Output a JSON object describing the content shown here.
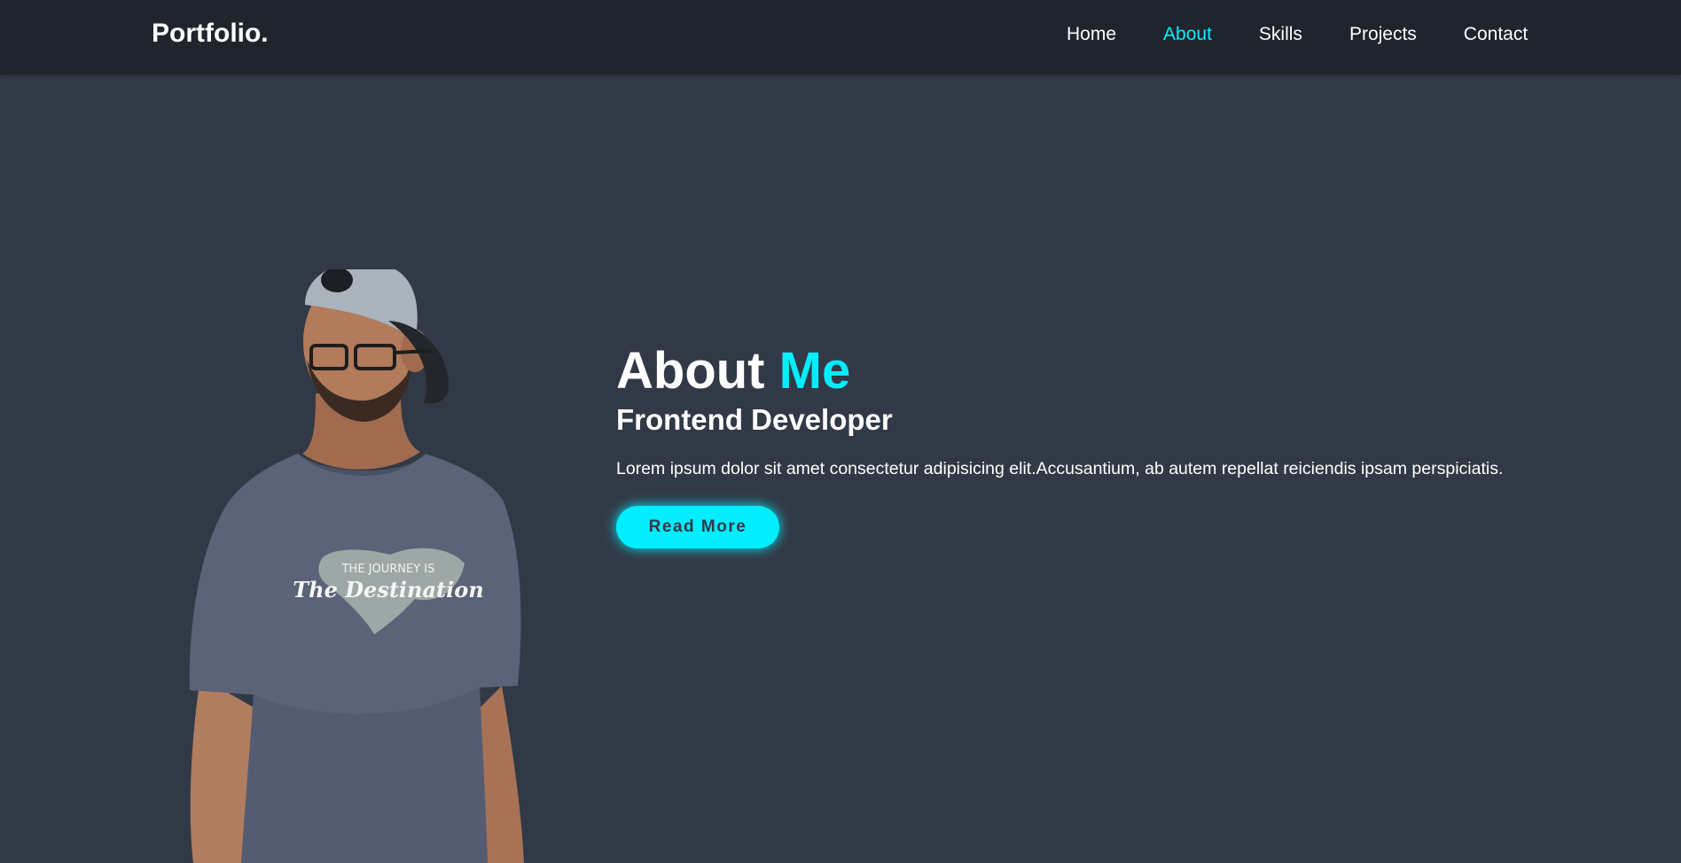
{
  "header": {
    "logo": "Portfolio.",
    "nav": [
      {
        "label": "Home",
        "active": false
      },
      {
        "label": "About",
        "active": true
      },
      {
        "label": "Skills",
        "active": false
      },
      {
        "label": "Projects",
        "active": false
      },
      {
        "label": "Contact",
        "active": false
      }
    ]
  },
  "about": {
    "heading_main": "About",
    "heading_accent": "Me",
    "subtitle": "Frontend Developer",
    "description": "Lorem ipsum dolor sit amet consectetur adipisicing elit.Accusantium, ab autem repellat reiciendis ipsam perspiciatis.",
    "button_label": "Read More",
    "shirt_text_top": "THE JOURNEY IS",
    "shirt_text_bottom": "The Destination"
  },
  "colors": {
    "background": "#323946",
    "header_background": "#1f242d",
    "accent": "#00eeff",
    "text": "#ffffff"
  }
}
